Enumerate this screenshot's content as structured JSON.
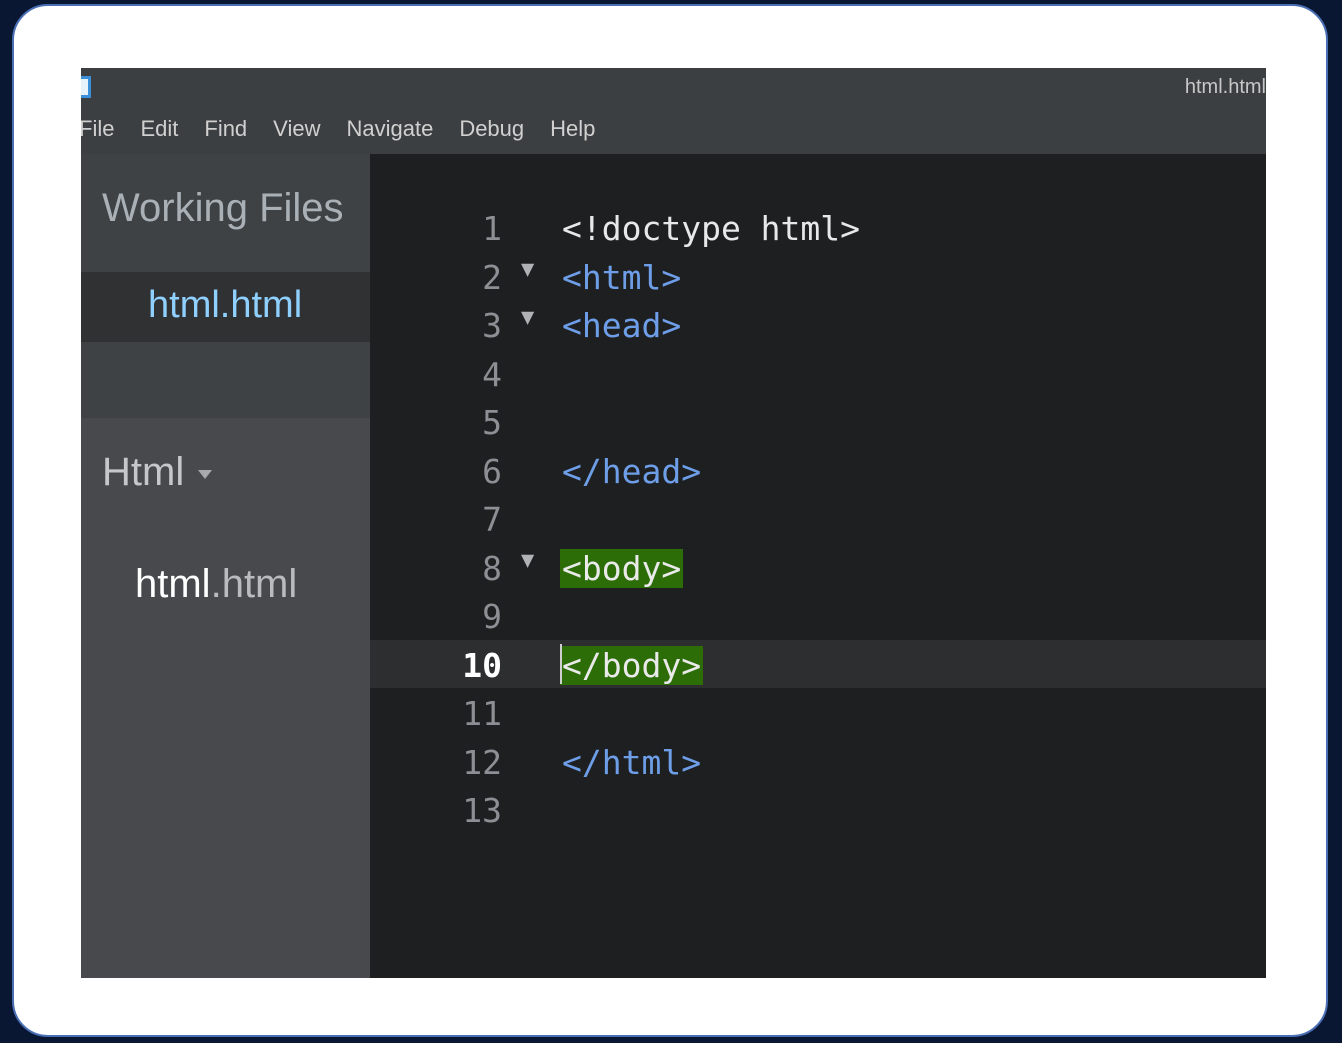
{
  "window": {
    "title": "html.html"
  },
  "menu": [
    "File",
    "Edit",
    "Find",
    "View",
    "Navigate",
    "Debug",
    "Help"
  ],
  "sidebar": {
    "working_files_title": "Working Files",
    "working_files": [
      "html.html"
    ],
    "project": {
      "name": "Html",
      "files": [
        {
          "base": "html",
          "ext": ".html"
        }
      ]
    }
  },
  "editor": {
    "active_line": 10,
    "lines": [
      {
        "num": "1",
        "fold": "",
        "text": "<!doctype html>",
        "kind": "doctype"
      },
      {
        "num": "2",
        "fold": "▼",
        "text": "<html>",
        "kind": "tag"
      },
      {
        "num": "3",
        "fold": "▼",
        "text": "<head>",
        "kind": "tag"
      },
      {
        "num": "4",
        "fold": "",
        "text": "",
        "kind": "tag"
      },
      {
        "num": "5",
        "fold": "",
        "text": "",
        "kind": "tag"
      },
      {
        "num": "6",
        "fold": "",
        "text": "</head>",
        "kind": "tag"
      },
      {
        "num": "7",
        "fold": "",
        "text": "",
        "kind": "tag"
      },
      {
        "num": "8",
        "fold": "▼",
        "text": "<body>",
        "kind": "match"
      },
      {
        "num": "9",
        "fold": "",
        "text": "",
        "kind": "tag"
      },
      {
        "num": "10",
        "fold": "",
        "text": "</body>",
        "kind": "match"
      },
      {
        "num": "11",
        "fold": "",
        "text": "",
        "kind": "tag"
      },
      {
        "num": "12",
        "fold": "",
        "text": "</html>",
        "kind": "tag"
      },
      {
        "num": "13",
        "fold": "",
        "text": "",
        "kind": "tag"
      }
    ]
  },
  "colors": {
    "tag": "#6e9ee8",
    "match_highlight": "#2c6d08",
    "working_file_active": "#8fd0ff"
  }
}
